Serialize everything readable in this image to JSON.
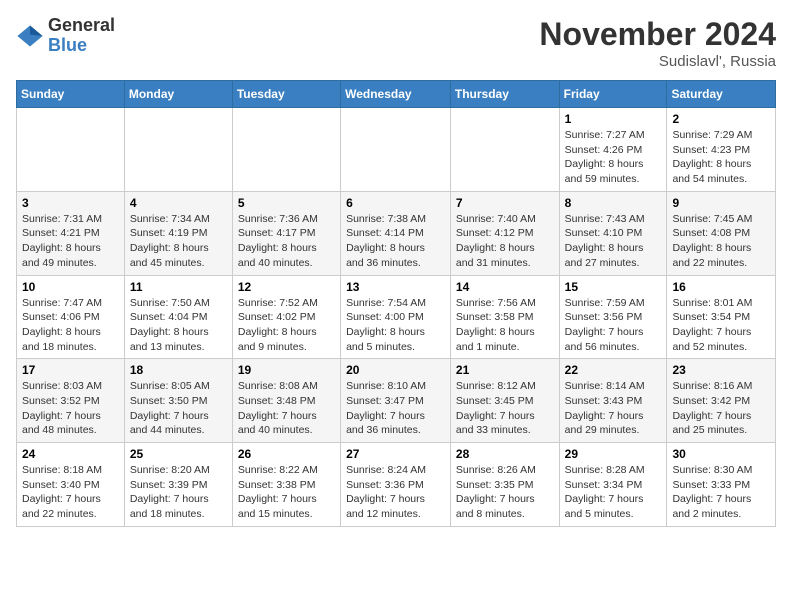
{
  "header": {
    "logo": {
      "general": "General",
      "blue": "Blue"
    },
    "title": "November 2024",
    "location": "Sudislavl', Russia"
  },
  "days_of_week": [
    "Sunday",
    "Monday",
    "Tuesday",
    "Wednesday",
    "Thursday",
    "Friday",
    "Saturday"
  ],
  "weeks": [
    [
      {
        "day": "",
        "info": ""
      },
      {
        "day": "",
        "info": ""
      },
      {
        "day": "",
        "info": ""
      },
      {
        "day": "",
        "info": ""
      },
      {
        "day": "",
        "info": ""
      },
      {
        "day": "1",
        "info": "Sunrise: 7:27 AM\nSunset: 4:26 PM\nDaylight: 8 hours\nand 59 minutes."
      },
      {
        "day": "2",
        "info": "Sunrise: 7:29 AM\nSunset: 4:23 PM\nDaylight: 8 hours\nand 54 minutes."
      }
    ],
    [
      {
        "day": "3",
        "info": "Sunrise: 7:31 AM\nSunset: 4:21 PM\nDaylight: 8 hours\nand 49 minutes."
      },
      {
        "day": "4",
        "info": "Sunrise: 7:34 AM\nSunset: 4:19 PM\nDaylight: 8 hours\nand 45 minutes."
      },
      {
        "day": "5",
        "info": "Sunrise: 7:36 AM\nSunset: 4:17 PM\nDaylight: 8 hours\nand 40 minutes."
      },
      {
        "day": "6",
        "info": "Sunrise: 7:38 AM\nSunset: 4:14 PM\nDaylight: 8 hours\nand 36 minutes."
      },
      {
        "day": "7",
        "info": "Sunrise: 7:40 AM\nSunset: 4:12 PM\nDaylight: 8 hours\nand 31 minutes."
      },
      {
        "day": "8",
        "info": "Sunrise: 7:43 AM\nSunset: 4:10 PM\nDaylight: 8 hours\nand 27 minutes."
      },
      {
        "day": "9",
        "info": "Sunrise: 7:45 AM\nSunset: 4:08 PM\nDaylight: 8 hours\nand 22 minutes."
      }
    ],
    [
      {
        "day": "10",
        "info": "Sunrise: 7:47 AM\nSunset: 4:06 PM\nDaylight: 8 hours\nand 18 minutes."
      },
      {
        "day": "11",
        "info": "Sunrise: 7:50 AM\nSunset: 4:04 PM\nDaylight: 8 hours\nand 13 minutes."
      },
      {
        "day": "12",
        "info": "Sunrise: 7:52 AM\nSunset: 4:02 PM\nDaylight: 8 hours\nand 9 minutes."
      },
      {
        "day": "13",
        "info": "Sunrise: 7:54 AM\nSunset: 4:00 PM\nDaylight: 8 hours\nand 5 minutes."
      },
      {
        "day": "14",
        "info": "Sunrise: 7:56 AM\nSunset: 3:58 PM\nDaylight: 8 hours\nand 1 minute."
      },
      {
        "day": "15",
        "info": "Sunrise: 7:59 AM\nSunset: 3:56 PM\nDaylight: 7 hours\nand 56 minutes."
      },
      {
        "day": "16",
        "info": "Sunrise: 8:01 AM\nSunset: 3:54 PM\nDaylight: 7 hours\nand 52 minutes."
      }
    ],
    [
      {
        "day": "17",
        "info": "Sunrise: 8:03 AM\nSunset: 3:52 PM\nDaylight: 7 hours\nand 48 minutes."
      },
      {
        "day": "18",
        "info": "Sunrise: 8:05 AM\nSunset: 3:50 PM\nDaylight: 7 hours\nand 44 minutes."
      },
      {
        "day": "19",
        "info": "Sunrise: 8:08 AM\nSunset: 3:48 PM\nDaylight: 7 hours\nand 40 minutes."
      },
      {
        "day": "20",
        "info": "Sunrise: 8:10 AM\nSunset: 3:47 PM\nDaylight: 7 hours\nand 36 minutes."
      },
      {
        "day": "21",
        "info": "Sunrise: 8:12 AM\nSunset: 3:45 PM\nDaylight: 7 hours\nand 33 minutes."
      },
      {
        "day": "22",
        "info": "Sunrise: 8:14 AM\nSunset: 3:43 PM\nDaylight: 7 hours\nand 29 minutes."
      },
      {
        "day": "23",
        "info": "Sunrise: 8:16 AM\nSunset: 3:42 PM\nDaylight: 7 hours\nand 25 minutes."
      }
    ],
    [
      {
        "day": "24",
        "info": "Sunrise: 8:18 AM\nSunset: 3:40 PM\nDaylight: 7 hours\nand 22 minutes."
      },
      {
        "day": "25",
        "info": "Sunrise: 8:20 AM\nSunset: 3:39 PM\nDaylight: 7 hours\nand 18 minutes."
      },
      {
        "day": "26",
        "info": "Sunrise: 8:22 AM\nSunset: 3:38 PM\nDaylight: 7 hours\nand 15 minutes."
      },
      {
        "day": "27",
        "info": "Sunrise: 8:24 AM\nSunset: 3:36 PM\nDaylight: 7 hours\nand 12 minutes."
      },
      {
        "day": "28",
        "info": "Sunrise: 8:26 AM\nSunset: 3:35 PM\nDaylight: 7 hours\nand 8 minutes."
      },
      {
        "day": "29",
        "info": "Sunrise: 8:28 AM\nSunset: 3:34 PM\nDaylight: 7 hours\nand 5 minutes."
      },
      {
        "day": "30",
        "info": "Sunrise: 8:30 AM\nSunset: 3:33 PM\nDaylight: 7 hours\nand 2 minutes."
      }
    ]
  ]
}
